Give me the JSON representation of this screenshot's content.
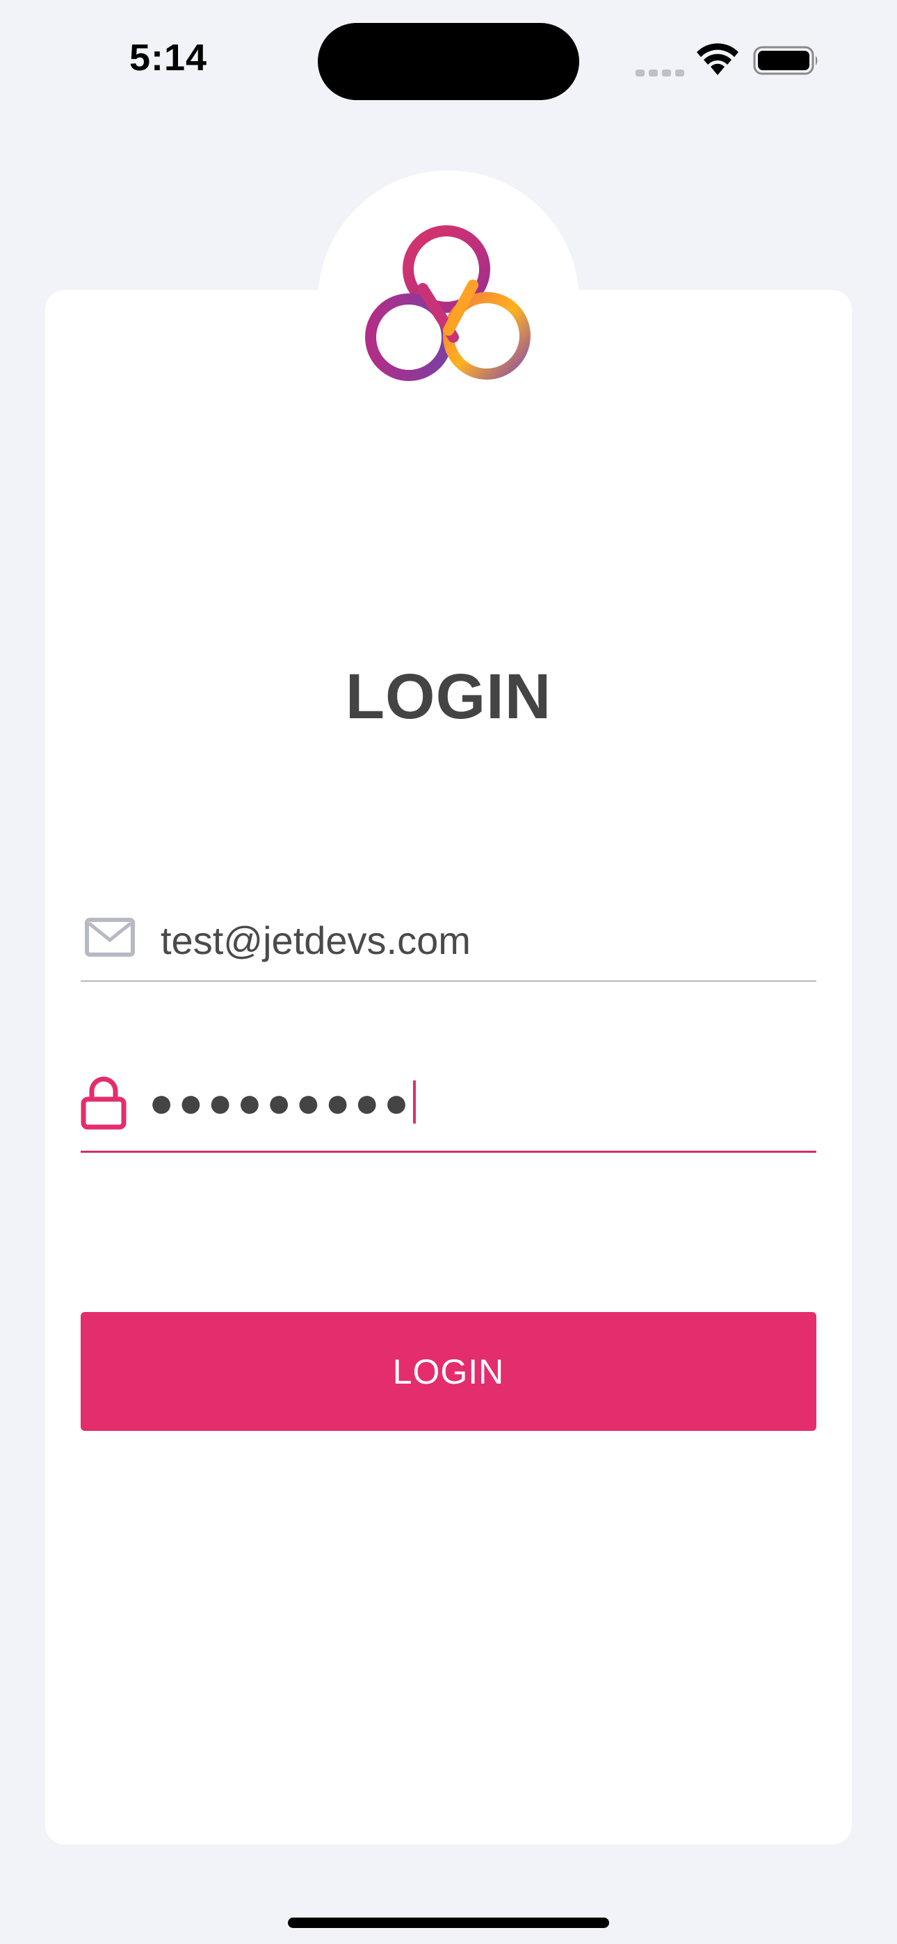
{
  "status_bar": {
    "time": "5:14",
    "cellular_icon": "cellular-signal-icon",
    "wifi_icon": "wifi-icon",
    "battery_icon": "battery-icon"
  },
  "login": {
    "logo_icon": "app-logo-icon",
    "title": "LOGIN",
    "email": {
      "icon": "mail-icon",
      "value": "test@jetdevs.com"
    },
    "password": {
      "icon": "lock-icon",
      "masked_value": "●●●●●●●●●",
      "focused": true
    },
    "button_label": "LOGIN"
  },
  "colors": {
    "accent": "#e42d6d",
    "background": "#f2f3f8",
    "card": "#ffffff",
    "text": "#444444"
  }
}
